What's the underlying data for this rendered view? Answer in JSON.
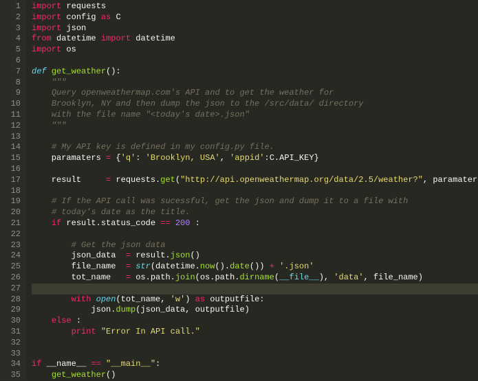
{
  "lines": [
    {
      "n": 1,
      "tokens": [
        [
          "kw",
          "import"
        ],
        [
          "txt",
          " "
        ],
        [
          "txt",
          "requests"
        ]
      ]
    },
    {
      "n": 2,
      "tokens": [
        [
          "kw",
          "import"
        ],
        [
          "txt",
          " "
        ],
        [
          "txt",
          "config "
        ],
        [
          "kw",
          "as"
        ],
        [
          "txt",
          " "
        ],
        [
          "txt",
          "C"
        ]
      ]
    },
    {
      "n": 3,
      "tokens": [
        [
          "kw",
          "import"
        ],
        [
          "txt",
          " "
        ],
        [
          "txt",
          "json"
        ]
      ]
    },
    {
      "n": 4,
      "tokens": [
        [
          "kw",
          "from"
        ],
        [
          "txt",
          " "
        ],
        [
          "txt",
          "datetime "
        ],
        [
          "kw",
          "import"
        ],
        [
          "txt",
          " "
        ],
        [
          "txt",
          "datetime"
        ]
      ]
    },
    {
      "n": 5,
      "tokens": [
        [
          "kw",
          "import"
        ],
        [
          "txt",
          " "
        ],
        [
          "txt",
          "os"
        ]
      ]
    },
    {
      "n": 6,
      "tokens": []
    },
    {
      "n": 7,
      "tokens": [
        [
          "cls",
          "def "
        ],
        [
          "fn",
          "get_weather"
        ],
        [
          "txt",
          "():"
        ]
      ]
    },
    {
      "n": 8,
      "tokens": [
        [
          "txt",
          "    "
        ],
        [
          "com",
          "\"\"\""
        ]
      ]
    },
    {
      "n": 9,
      "tokens": [
        [
          "txt",
          "    "
        ],
        [
          "com",
          "Query openweathermap.com's API and to get the weather for"
        ]
      ]
    },
    {
      "n": 10,
      "tokens": [
        [
          "txt",
          "    "
        ],
        [
          "com",
          "Brooklyn, NY and then dump the json to the /src/data/ directory"
        ]
      ]
    },
    {
      "n": 11,
      "tokens": [
        [
          "txt",
          "    "
        ],
        [
          "com",
          "with the file name \"<today's date>.json\""
        ]
      ]
    },
    {
      "n": 12,
      "tokens": [
        [
          "txt",
          "    "
        ],
        [
          "com",
          "\"\"\""
        ]
      ]
    },
    {
      "n": 13,
      "tokens": []
    },
    {
      "n": 14,
      "tokens": [
        [
          "txt",
          "    "
        ],
        [
          "com",
          "# My API key is defined in my config.py file."
        ]
      ]
    },
    {
      "n": 15,
      "tokens": [
        [
          "txt",
          "    paramaters "
        ],
        [
          "op",
          "="
        ],
        [
          "txt",
          " {"
        ],
        [
          "str",
          "'q'"
        ],
        [
          "txt",
          ": "
        ],
        [
          "str",
          "'Brooklyn, USA'"
        ],
        [
          "txt",
          ", "
        ],
        [
          "str",
          "'appid'"
        ],
        [
          "txt",
          ":C.API_KEY}"
        ]
      ]
    },
    {
      "n": 16,
      "tokens": []
    },
    {
      "n": 17,
      "tokens": [
        [
          "txt",
          "    result     "
        ],
        [
          "op",
          "="
        ],
        [
          "txt",
          " requests."
        ],
        [
          "fn",
          "get"
        ],
        [
          "txt",
          "("
        ],
        [
          "str",
          "\"http://api.openweathermap.org/data/2.5/weather?\""
        ],
        [
          "txt",
          ", paramaters)"
        ]
      ]
    },
    {
      "n": 18,
      "tokens": []
    },
    {
      "n": 19,
      "tokens": [
        [
          "txt",
          "    "
        ],
        [
          "com",
          "# If the API call was sucessful, get the json and dump it to a file with"
        ]
      ]
    },
    {
      "n": 20,
      "tokens": [
        [
          "txt",
          "    "
        ],
        [
          "com",
          "# today's date as the title."
        ]
      ]
    },
    {
      "n": 21,
      "tokens": [
        [
          "txt",
          "    "
        ],
        [
          "kw",
          "if"
        ],
        [
          "txt",
          " result.status_code "
        ],
        [
          "op",
          "=="
        ],
        [
          "txt",
          " "
        ],
        [
          "num",
          "200"
        ],
        [
          "txt",
          " :"
        ]
      ]
    },
    {
      "n": 22,
      "tokens": []
    },
    {
      "n": 23,
      "tokens": [
        [
          "txt",
          "        "
        ],
        [
          "com",
          "# Get the json data"
        ]
      ]
    },
    {
      "n": 24,
      "tokens": [
        [
          "txt",
          "        json_data  "
        ],
        [
          "op",
          "="
        ],
        [
          "txt",
          " result."
        ],
        [
          "fn",
          "json"
        ],
        [
          "txt",
          "()"
        ]
      ]
    },
    {
      "n": 25,
      "tokens": [
        [
          "txt",
          "        file_name  "
        ],
        [
          "op",
          "="
        ],
        [
          "txt",
          " "
        ],
        [
          "cls",
          "str"
        ],
        [
          "txt",
          "(datetime."
        ],
        [
          "fn",
          "now"
        ],
        [
          "txt",
          "()."
        ],
        [
          "fn",
          "date"
        ],
        [
          "txt",
          "()) "
        ],
        [
          "op",
          "+"
        ],
        [
          "txt",
          " "
        ],
        [
          "str",
          "'.json'"
        ]
      ]
    },
    {
      "n": 26,
      "tokens": [
        [
          "txt",
          "        tot_name   "
        ],
        [
          "op",
          "="
        ],
        [
          "txt",
          " os.path."
        ],
        [
          "fn",
          "join"
        ],
        [
          "txt",
          "(os.path."
        ],
        [
          "fn",
          "dirname"
        ],
        [
          "txt",
          "("
        ],
        [
          "name",
          "__file__"
        ],
        [
          "txt",
          "), "
        ],
        [
          "str",
          "'data'"
        ],
        [
          "txt",
          ", file_name)"
        ]
      ]
    },
    {
      "n": 27,
      "hl": true,
      "tokens": []
    },
    {
      "n": 28,
      "tokens": [
        [
          "txt",
          "        "
        ],
        [
          "kw",
          "with"
        ],
        [
          "txt",
          " "
        ],
        [
          "cls",
          "open"
        ],
        [
          "txt",
          "(tot_name, "
        ],
        [
          "str",
          "'w'"
        ],
        [
          "txt",
          ") "
        ],
        [
          "kw",
          "as"
        ],
        [
          "txt",
          " outputfile:"
        ]
      ]
    },
    {
      "n": 29,
      "tokens": [
        [
          "txt",
          "            json."
        ],
        [
          "fn",
          "dump"
        ],
        [
          "txt",
          "(json_data, outputfile)"
        ]
      ]
    },
    {
      "n": 30,
      "tokens": [
        [
          "txt",
          "    "
        ],
        [
          "kw",
          "else"
        ],
        [
          "txt",
          " :"
        ]
      ]
    },
    {
      "n": 31,
      "tokens": [
        [
          "txt",
          "        "
        ],
        [
          "kw",
          "print"
        ],
        [
          "txt",
          " "
        ],
        [
          "str",
          "\"Error In API call.\""
        ]
      ]
    },
    {
      "n": 32,
      "tokens": []
    },
    {
      "n": 33,
      "tokens": []
    },
    {
      "n": 34,
      "tokens": [
        [
          "kw",
          "if"
        ],
        [
          "txt",
          " __name__ "
        ],
        [
          "op",
          "=="
        ],
        [
          "txt",
          " "
        ],
        [
          "str",
          "\"__main__\""
        ],
        [
          "txt",
          ":"
        ]
      ]
    },
    {
      "n": 35,
      "tokens": [
        [
          "txt",
          "    "
        ],
        [
          "fn",
          "get_weather"
        ],
        [
          "txt",
          "()"
        ]
      ]
    }
  ]
}
